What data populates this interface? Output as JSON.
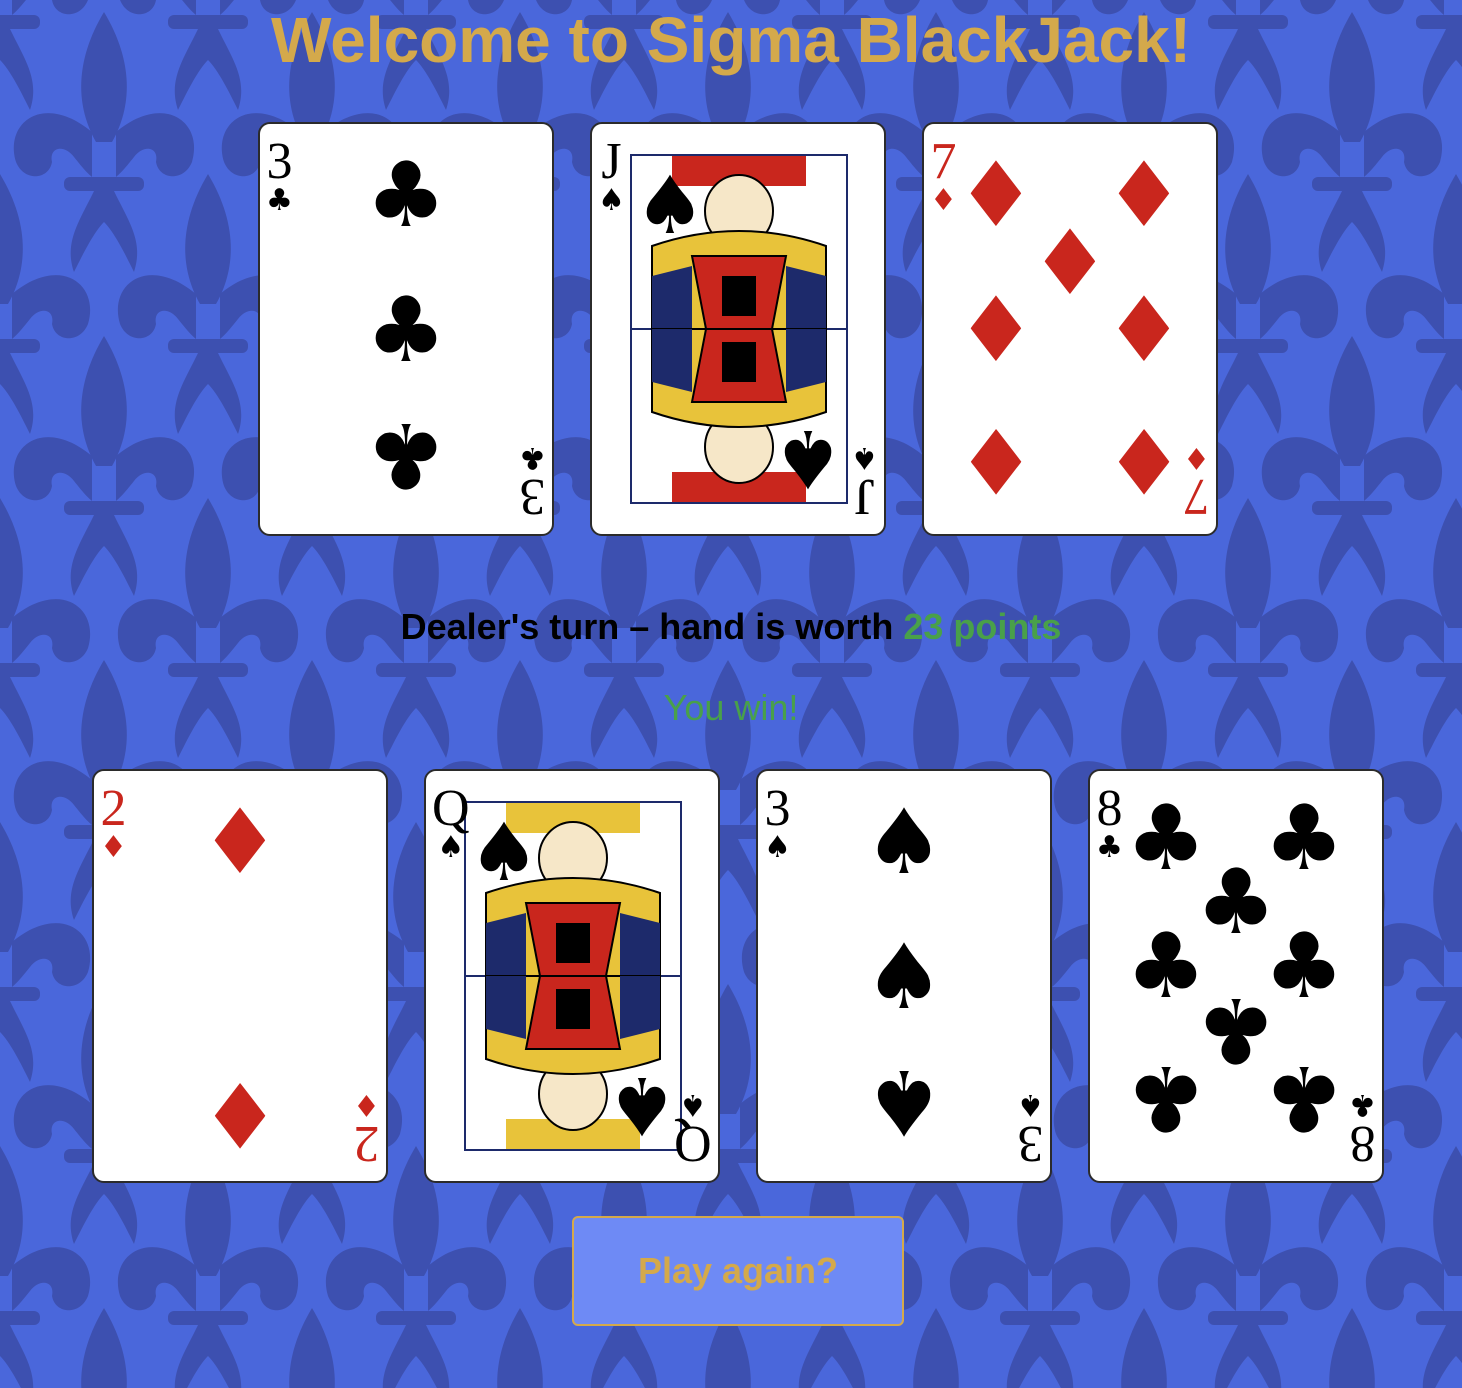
{
  "title": "Welcome to Sigma BlackJack!",
  "colors": {
    "background": "#4a67db",
    "pattern": "#3d50b0",
    "gold": "#d4a94b",
    "green": "#49a04a",
    "red_suit": "#c9261d",
    "button_bg": "#6e8af5"
  },
  "dealer_hand": [
    {
      "rank": "3",
      "suit": "♣",
      "color": "black"
    },
    {
      "rank": "J",
      "suit": "♠",
      "color": "black",
      "face": true
    },
    {
      "rank": "7",
      "suit": "♦",
      "color": "red"
    }
  ],
  "status": {
    "text": "Dealer's turn – hand is worth ",
    "points": "23 points"
  },
  "result": "You win!",
  "player_hand": [
    {
      "rank": "2",
      "suit": "♦",
      "color": "red"
    },
    {
      "rank": "Q",
      "suit": "♠",
      "color": "black",
      "face": true
    },
    {
      "rank": "3",
      "suit": "♠",
      "color": "black"
    },
    {
      "rank": "8",
      "suit": "♣",
      "color": "black"
    }
  ],
  "button": {
    "label": "Play again?"
  }
}
